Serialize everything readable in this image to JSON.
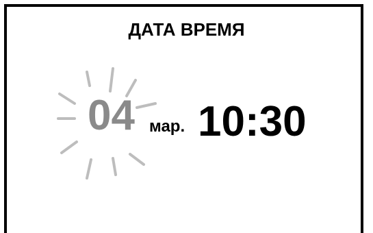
{
  "screen": {
    "title": "ДАТА ВРЕМЯ",
    "date": {
      "day": "04",
      "month": "мар."
    },
    "time": "10:30"
  },
  "colors": {
    "highlight_day": "#8a8a8a",
    "text": "#000000",
    "border": "#000000",
    "background": "#ffffff"
  }
}
